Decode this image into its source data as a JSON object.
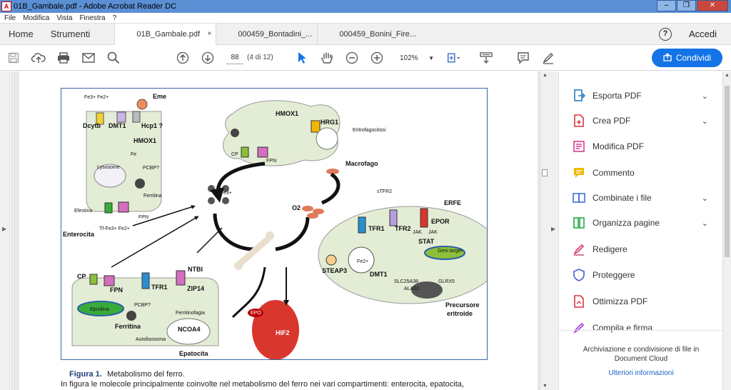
{
  "window": {
    "title": "01B_Gambale.pdf - Adobe Acrobat Reader DC",
    "app_icon": "pdf-icon",
    "minimize_icon": "minimize-icon",
    "maximize_icon": "restore-icon",
    "close_icon": "close-icon"
  },
  "menu": [
    "File",
    "Modifica",
    "Vista",
    "Finestra",
    "?"
  ],
  "tabs": {
    "home": "Home",
    "tools": "Strumenti",
    "documents": [
      {
        "label": "01B_Gambale.pdf",
        "active": true,
        "close": "×"
      },
      {
        "label": "000459_Bontadini_...",
        "active": false
      },
      {
        "label": "000459_Bonini_Fire...",
        "active": false
      }
    ],
    "help": "?",
    "signin": "Accedi"
  },
  "toolbar": {
    "page_value": "88",
    "page_count": "(4 di 12)",
    "zoom": "102%",
    "share": "Condividi"
  },
  "figure": {
    "labels": {
      "eme": "Eme",
      "fe_top": "Fe3+  Fe2+",
      "dcytb": "Dcytb",
      "dmt1": "DMT1",
      "hcp1": "Hcp1 ?",
      "hmox1_left": "HMOX1",
      "fe": "Fe",
      "lysosome": "Lysosome",
      "pcbp": "PCBP?",
      "ferritina": "Ferritina",
      "efestina": "Efestina",
      "fpn_ent": "FPN",
      "tffe": "Tf-Fe3+  Fe2+",
      "enterocita": "Enterocita",
      "tf_fe3": "Tf-Fe3+",
      "hmox1_mac": "HMOX1",
      "hrg1": "HRG1",
      "eritrofagocitosi": "Eritrofagocitosi",
      "cp_mac": "CP",
      "fpn_mac": "FPN",
      "macrofago": "Macrofago",
      "o2": "O2",
      "stfr2": "sTFR2",
      "erfe": "ERFE",
      "tfr1_er": "TFR1",
      "tfr2": "TFR2",
      "epor": "EPOR",
      "jak1": "JAK",
      "jak2": "JAK",
      "stat": "STAT",
      "geni_target": "Geni target",
      "steap3": "STEAP3",
      "fe2": "Fe2+",
      "dmt1_er": "DMT1",
      "slc25a38": "SLC25A38",
      "alas2": "ALAS2",
      "glrx5": "GLRX5",
      "precursore": "Precursore",
      "eritroide": "eritroide",
      "cp_hep": "CP",
      "fpn_hep": "FPN",
      "tfr1_hep": "TFR1",
      "ntbi": "NTBI",
      "zip14": "ZIP14",
      "epcidina": "Epcidina",
      "pcbp_hep": "PCBP?",
      "ferritinofagia": "Ferritinofagia",
      "ferritina_hep": "Ferritina",
      "ncoa4": "NCOA4",
      "autolisosoma": "Autolisosoma",
      "epatocita": "Epatocita",
      "epo": "EPO",
      "hif2": "HIF2"
    }
  },
  "caption": {
    "label": "Figura 1.",
    "title": "Metabolismo del ferro.",
    "text": "In figura le molecole principalmente coinvolte nel metabolismo del ferro nei vari compartimenti: enterocita, epatocita,"
  },
  "tools_panel": {
    "items": [
      {
        "label": "Esporta PDF",
        "icon": "export-pdf-icon",
        "color": "#2d7fbf",
        "chevron": true
      },
      {
        "label": "Crea PDF",
        "icon": "create-pdf-icon",
        "color": "#d9363e",
        "chevron": true
      },
      {
        "label": "Modifica PDF",
        "icon": "edit-pdf-icon",
        "color": "#d63d8f",
        "chevron": false
      },
      {
        "label": "Commento",
        "icon": "comment-icon",
        "color": "#f2b705",
        "chevron": false
      },
      {
        "label": "Combinate i file",
        "icon": "combine-files-icon",
        "color": "#3d6fd6",
        "chevron": true
      },
      {
        "label": "Organizza pagine",
        "icon": "organize-pages-icon",
        "color": "#27a643",
        "chevron": true
      },
      {
        "label": "Redigere",
        "icon": "redact-icon",
        "color": "#d63d6f",
        "chevron": false
      },
      {
        "label": "Proteggere",
        "icon": "protect-icon",
        "color": "#4a5fd0",
        "chevron": false
      },
      {
        "label": "Ottimizza PDF",
        "icon": "optimize-pdf-icon",
        "color": "#d9363e",
        "chevron": false
      },
      {
        "label": "Compila e firma",
        "icon": "fill-sign-icon",
        "color": "#a33fd6",
        "chevron": false
      }
    ],
    "footer_text": "Archiviazione e condivisione di file in Document Cloud",
    "footer_link": "Ulteriori informazioni"
  }
}
